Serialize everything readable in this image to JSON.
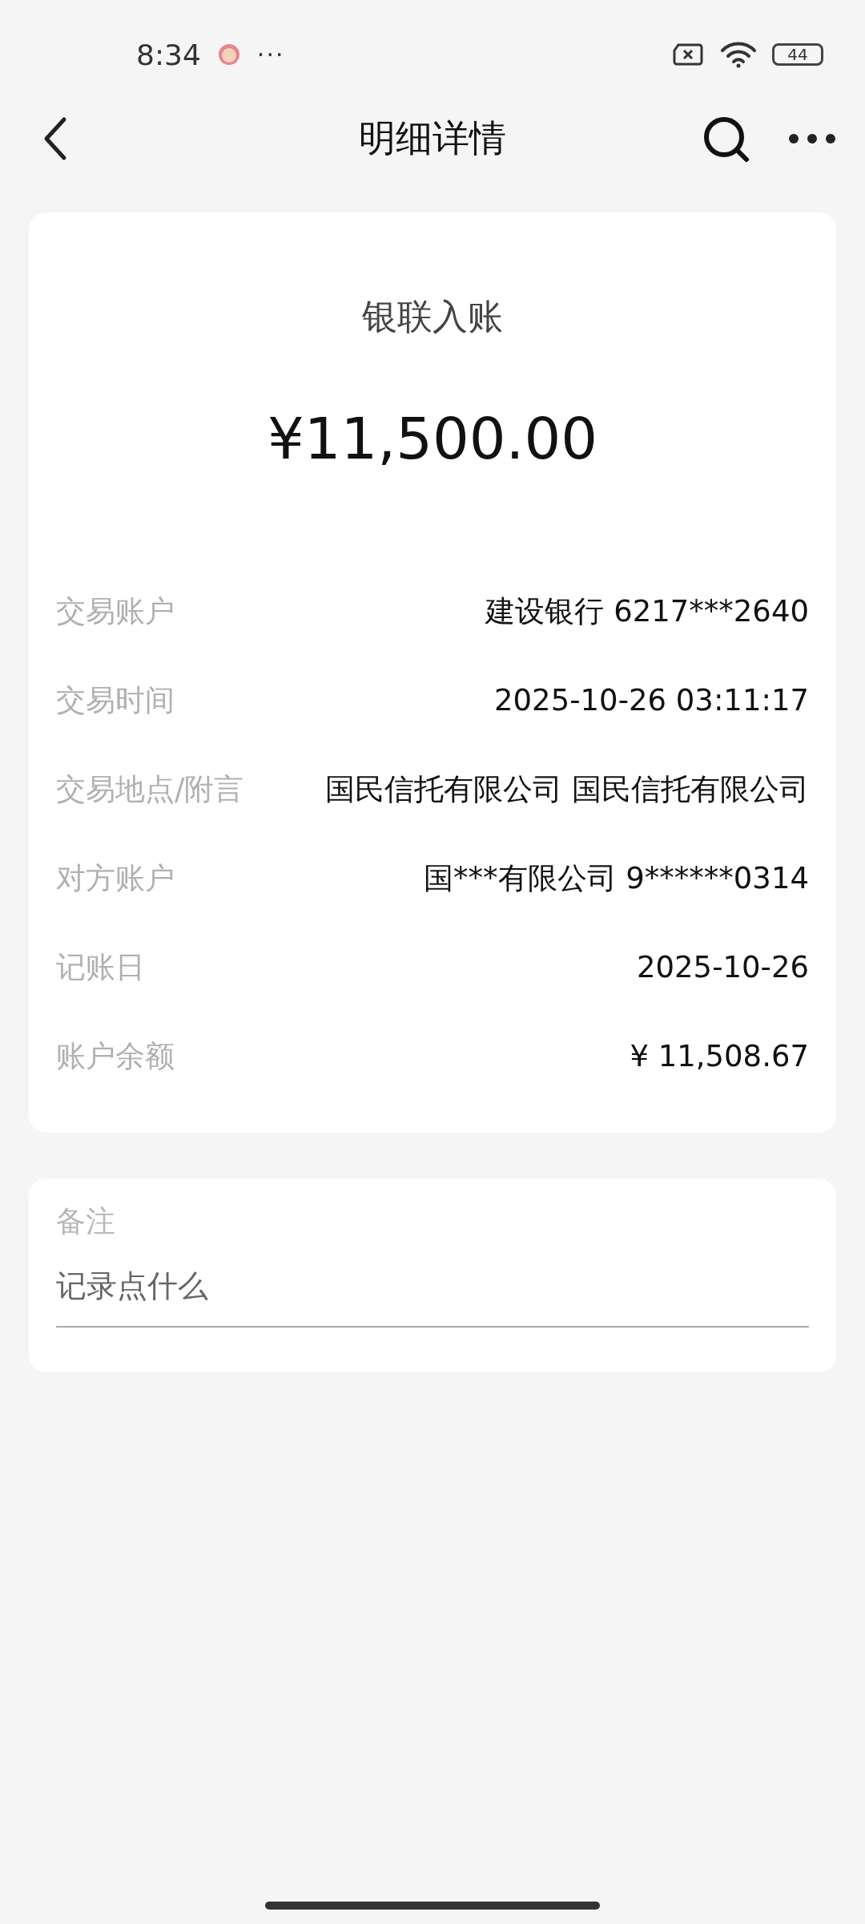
{
  "status_bar": {
    "time": "8:34",
    "more": "···",
    "battery": "44"
  },
  "header": {
    "title": "明细详情"
  },
  "summary": {
    "type": "银联入账",
    "amount": "¥11,500.00"
  },
  "details": [
    {
      "label": "交易账户",
      "value": "建设银行 6217***2640"
    },
    {
      "label": "交易时间",
      "value": "2025-10-26 03:11:17"
    },
    {
      "label": "交易地点/附言",
      "value": "国民信托有限公司 国民信托有限公司"
    },
    {
      "label": "对方账户",
      "value": "国***有限公司 9******0314"
    },
    {
      "label": "记账日",
      "value": "2025-10-26"
    },
    {
      "label": "账户余额",
      "value": "¥ 11,508.67"
    }
  ],
  "note": {
    "label": "备注",
    "placeholder": "记录点什么"
  }
}
